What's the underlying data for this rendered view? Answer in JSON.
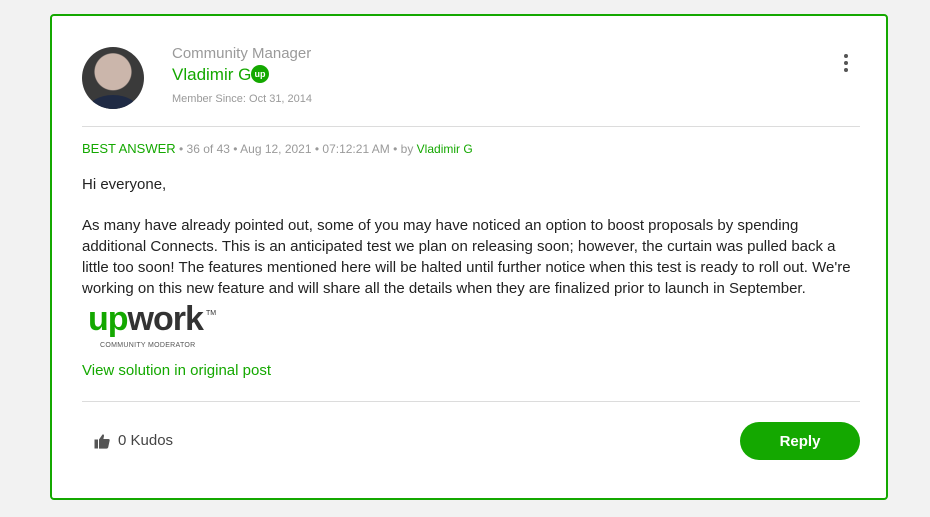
{
  "post": {
    "role": "Community Manager",
    "author": "Vladimir G",
    "badge": "up",
    "member_since": "Member Since: Oct 31, 2014",
    "best_answer": "BEST ANSWER",
    "meta": " • 36 of 43 • Aug 12, 2021 • 07:12:21 AM • by ",
    "by_name": "Vladimir G",
    "greeting": "Hi everyone,",
    "body": "As many have already pointed out, some of you may have noticed an option to boost proposals by spending additional Connects. This is an anticipated test we plan on releasing soon; however, the curtain was pulled back a little too soon! The features mentioned here will be halted until further notice when this test is ready to roll out. We're working on this new feature and will share all the details when they are finalized prior to launch in September.",
    "logo": {
      "up": "up",
      "work": "work",
      "tm": "TM",
      "subtitle": "COMMUNITY MODERATOR"
    },
    "view_solution": "View solution in original post"
  },
  "footer": {
    "kudos": "0 Kudos",
    "reply": "Reply"
  },
  "colors": {
    "accent": "#14a800",
    "border": "#14a800",
    "muted": "#9a9a9a"
  },
  "icons": [
    "avatar",
    "upwork-badge-icon",
    "kebab-menu-icon",
    "thumbs-up-icon"
  ]
}
